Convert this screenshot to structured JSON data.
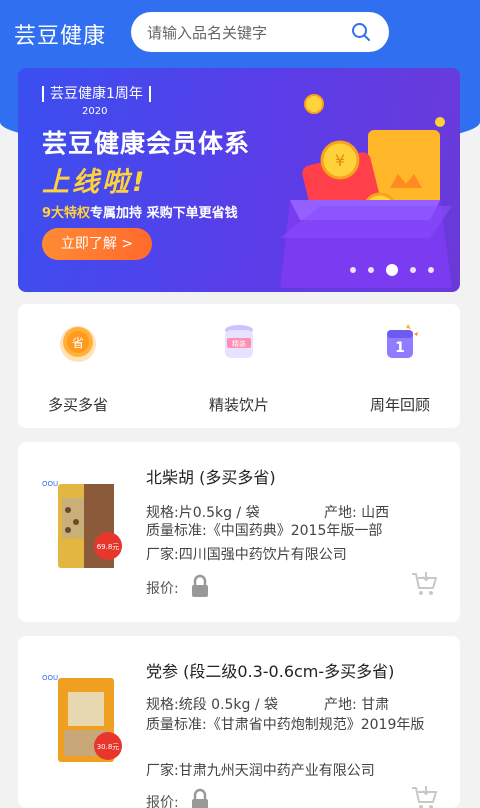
{
  "header": {
    "app_title": "芸豆健康",
    "search_placeholder": "请输入品名关键字"
  },
  "banner": {
    "anniversary_label": "芸豆健康1周年",
    "anniversary_year": "2020",
    "title": "芸豆健康会员体系",
    "slogan": "上线啦!",
    "subtitle_highlight": "9大特权",
    "subtitle_rest": "专属加持   采购下单更省钱",
    "button_label": "立即了解 >",
    "slide_count": 5,
    "active_slide": 2
  },
  "quick_links": [
    {
      "label": "多买多省",
      "icon": "save-badge-icon"
    },
    {
      "label": "精装饮片",
      "icon": "premium-jar-icon"
    },
    {
      "label": "周年回顾",
      "icon": "anniversary-calendar-icon"
    }
  ],
  "products": [
    {
      "name": "北柴胡 (多买多省)",
      "spec_label": "规格:",
      "spec": "片0.5kg / 袋",
      "origin_label": "产地:",
      "origin": "山西",
      "standard_label": "质量标准:",
      "standard": "《中国药典》2015年版一部",
      "maker_label": "厂家:",
      "maker": "四川国强中药饮片有限公司",
      "price_label": "报价:",
      "pack_brand": "OOU",
      "pack_price": "69.8元"
    },
    {
      "name": "党参 (段二级0.3-0.6cm-多买多省)",
      "spec_label": "规格:",
      "spec": "统段 0.5kg / 袋",
      "origin_label": "产地:",
      "origin": "甘肃",
      "standard_label": "质量标准:",
      "standard": "《甘肃省中药炮制规范》2019年版",
      "maker_label": "厂家:",
      "maker": "甘肃九州天润中药产业有限公司",
      "price_label": "报价:",
      "pack_brand": "OOU",
      "pack_price": "30.8元"
    }
  ],
  "colors": {
    "header_blue": "#2f6ff0",
    "accent_orange": "#ff7a2f",
    "banner_yellow": "#ffd23b"
  }
}
